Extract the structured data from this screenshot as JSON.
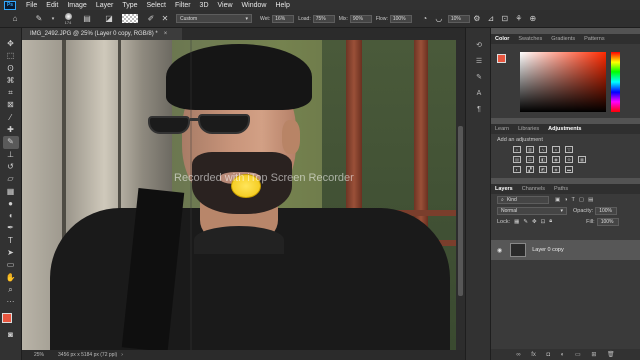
{
  "app": {
    "logo_text": "Ps",
    "menu": [
      "File",
      "Edit",
      "Image",
      "Layer",
      "Type",
      "Select",
      "Filter",
      "3D",
      "View",
      "Window",
      "Help"
    ]
  },
  "options": {
    "brush_size": "174",
    "preset": "Custom",
    "wet_label": "Wet:",
    "wet_value": "16%",
    "load_label": "Load:",
    "load_value": "75%",
    "mix_label": "Mix:",
    "mix_value": "90%",
    "flow_label": "Flow:",
    "flow_value": "100%",
    "smoothing_value": "10%"
  },
  "document": {
    "tab_title": "IMG_2492.JPG @ 25% (Layer 0 copy, RGB/8) *",
    "tab_close": "×",
    "watermark": "Recorded with iTop Screen Recorder",
    "status_zoom": "25%",
    "status_info": "3456 px x 5184 px (72 ppi)"
  },
  "panels": {
    "color_tabs": [
      "Color",
      "Swatches",
      "Gradients",
      "Patterns"
    ],
    "adjust_tabs": [
      "Learn",
      "Libraries",
      "Adjustments"
    ],
    "adjust_title": "Add an adjustment",
    "layer_tabs": [
      "Layers",
      "Channels",
      "Paths"
    ],
    "kind_label": "Kind",
    "blend_mode": "Normal",
    "opacity_label": "Opacity:",
    "opacity_value": "100%",
    "lock_label": "Lock:",
    "fill_label": "Fill:",
    "fill_value": "100%",
    "layer_name": "Layer 0 copy"
  },
  "colors": {
    "foreground": "#e9563f",
    "background": "#ffffff",
    "ui_dark": "#323232",
    "accent": "#31a8ff"
  }
}
